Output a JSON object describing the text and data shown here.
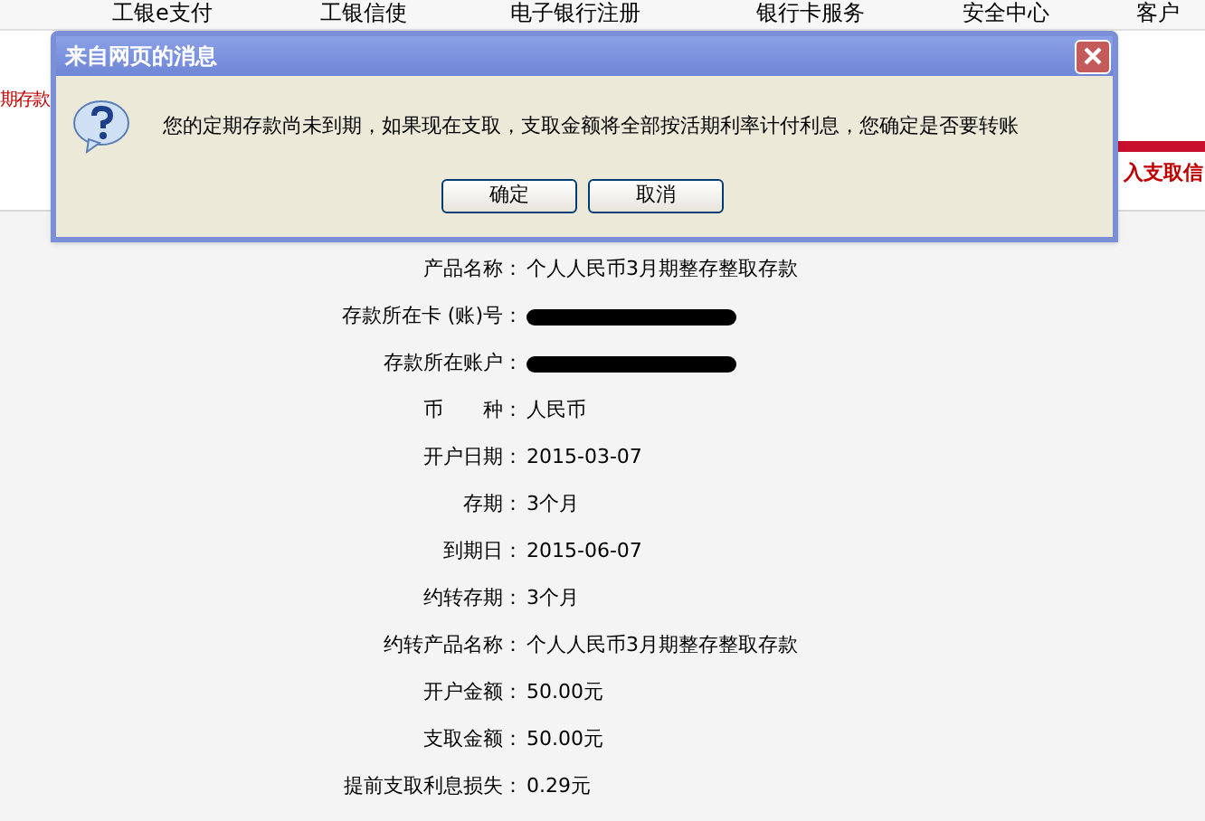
{
  "nav": [
    "工银e支付",
    "工银信使",
    "电子银行注册",
    "银行卡服务",
    "安全中心",
    "客户"
  ],
  "behind": {
    "left_tab": "期存款",
    "right_notice": "入支取信"
  },
  "dialog": {
    "title": "来自网页的消息",
    "message": "您的定期存款尚未到期，如果现在支取，支取金额将全部按活期利率计付利息，您确定是否要转账",
    "buttons": [
      "确定",
      "取消"
    ]
  },
  "details": [
    {
      "label": "产品名称：",
      "value": "个人人民币3月期整存整取存款"
    },
    {
      "label": "存款所在卡 (账)号：",
      "kind": "redacted"
    },
    {
      "label": "存款所在账户：",
      "kind": "redacted"
    },
    {
      "label": "币　　种：",
      "value": "人民币"
    },
    {
      "label": "开户日期：",
      "value": "2015-03-07"
    },
    {
      "label": "存期：",
      "value": "3个月"
    },
    {
      "label": "到期日：",
      "value": "2015-06-07"
    },
    {
      "label": "约转存期：",
      "value": "3个月"
    },
    {
      "label": "约转产品名称：",
      "value": "个人人民币3月期整存整取存款"
    },
    {
      "label": "开户金额：",
      "value": "50.00元"
    },
    {
      "label": "支取金额：",
      "value": "50.00元"
    },
    {
      "label": "提前支取利息损失：",
      "value": "0.29元"
    }
  ]
}
